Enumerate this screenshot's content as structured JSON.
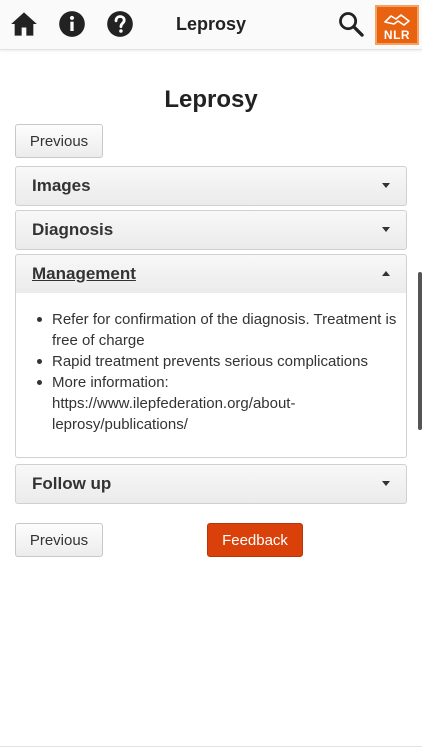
{
  "header": {
    "title": "Leprosy",
    "icons": {
      "home": "home-icon",
      "info": "info-icon",
      "help": "help-icon",
      "search": "search-icon"
    },
    "logo_text": "NLR"
  },
  "page": {
    "title": "Leprosy"
  },
  "nav": {
    "previous_label": "Previous",
    "feedback_label": "Feedback"
  },
  "accordion": {
    "images": {
      "label": "Images",
      "expanded": false
    },
    "diagnosis": {
      "label": "Diagnosis",
      "expanded": false
    },
    "management": {
      "label": "Management",
      "expanded": true,
      "items": [
        "Refer for confirmation of the diagnosis. Treatment is free of charge",
        "Rapid treatment prevents serious complications",
        "More information: https://www.ilepfederation.org/about-leprosy/publications/"
      ]
    },
    "follow_up": {
      "label": "Follow up",
      "expanded": false
    }
  },
  "colors": {
    "feedback_bg": "#d9400a",
    "logo_bg": "#e8620f",
    "header_bg": "#fafafa"
  }
}
